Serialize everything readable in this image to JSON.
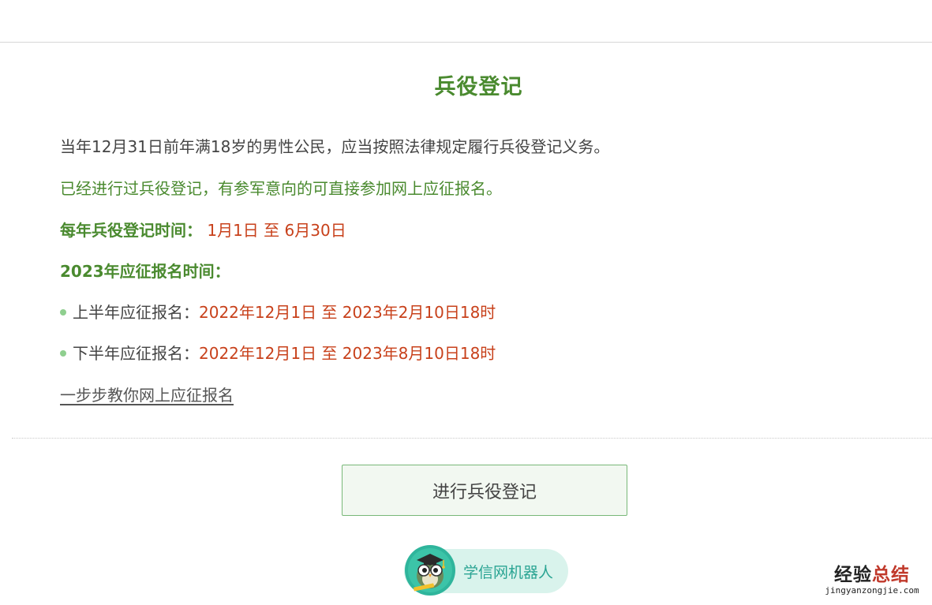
{
  "page": {
    "title": "兵役登记"
  },
  "content": {
    "intro": "当年12月31日前年满18岁的男性公民，应当按照法律规定履行兵役登记义务。",
    "note": "已经进行过兵役登记，有参军意向的可直接参加网上应征报名。",
    "annual_label": "每年兵役登记时间：",
    "annual_value": "1月1日 至 6月30日",
    "signup_heading": "2023年应征报名时间：",
    "signup_items": [
      {
        "label": "上半年应征报名：",
        "value": "2022年12月1日 至 2023年2月10日18时"
      },
      {
        "label": "下半年应征报名：",
        "value": "2022年12月1日 至 2023年8月10日18时"
      }
    ],
    "guide_link": "一步步教你网上应征报名"
  },
  "actions": {
    "register_button": "进行兵役登记"
  },
  "chatbot": {
    "label": "学信网机器人",
    "icon": "owl-mascot-icon"
  },
  "watermark": {
    "cn_part1": "经验",
    "cn_part2": "总结",
    "en": "jingyanzongjie.com"
  },
  "colors": {
    "accent_green": "#4a8a2f",
    "highlight_red": "#c8411b",
    "button_border": "#78b878",
    "button_bg": "#f2f8f1",
    "bot_bg": "#d9f3ec",
    "bot_text": "#2aa493"
  }
}
